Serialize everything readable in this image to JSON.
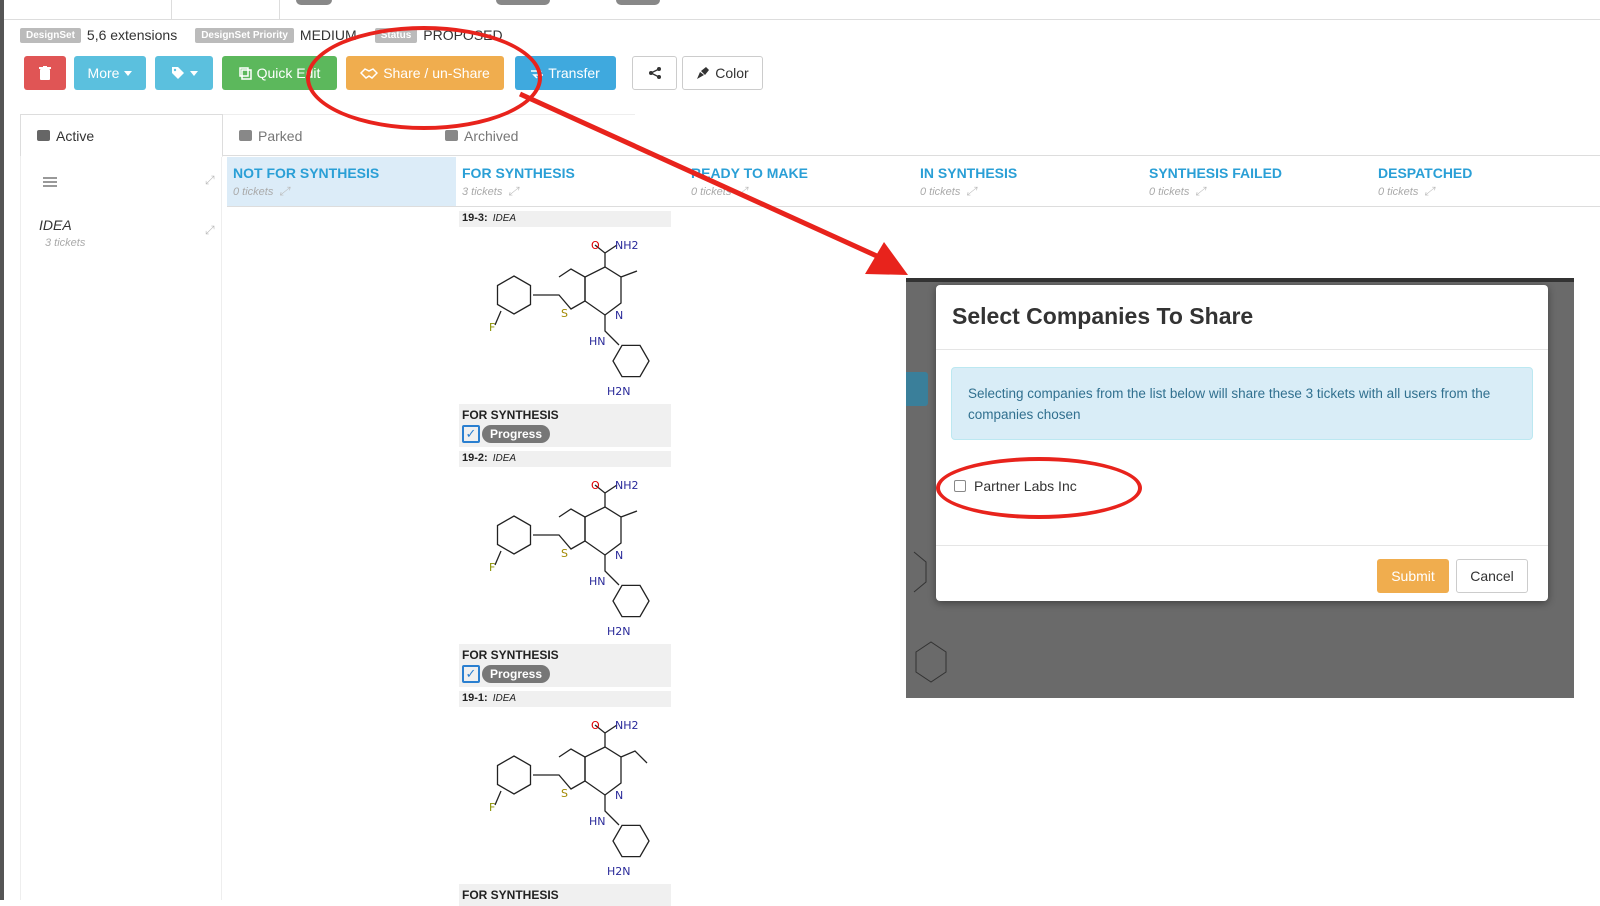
{
  "meta": {
    "designset_label": "DesignSet",
    "designset_value": "5,6 extensions",
    "priority_label": "DesignSet Priority",
    "priority_value": "MEDIUM",
    "status_label": "Status",
    "status_value": "PROPOSED"
  },
  "toolbar": {
    "delete_icon": "trash-icon",
    "more_label": "More",
    "tag_icon": "tag-icon",
    "quick_edit_label": "Quick Edit",
    "share_label": "Share / un-Share",
    "transfer_label": "Transfer",
    "share_icon": "share-nodes-icon",
    "color_label": "Color"
  },
  "status_tabs": [
    {
      "label": "Active"
    },
    {
      "label": "Parked"
    },
    {
      "label": "Archived"
    }
  ],
  "columns": [
    {
      "title": "NOT FOR SYNTHESIS",
      "count": "0 tickets"
    },
    {
      "title": "FOR SYNTHESIS",
      "count": "3 tickets"
    },
    {
      "title": "READY TO MAKE",
      "count": "0 tickets"
    },
    {
      "title": "IN SYNTHESIS",
      "count": "0 tickets"
    },
    {
      "title": "SYNTHESIS FAILED",
      "count": "0 tickets"
    },
    {
      "title": "DESPATCHED",
      "count": "0 tickets"
    }
  ],
  "row": {
    "title": "IDEA",
    "count": "3 tickets"
  },
  "cards": [
    {
      "id": "19-3:",
      "tag": "IDEA",
      "status": "FOR SYNTHESIS",
      "badge": "Progress"
    },
    {
      "id": "19-2:",
      "tag": "IDEA",
      "status": "FOR SYNTHESIS",
      "badge": "Progress"
    },
    {
      "id": "19-1:",
      "tag": "IDEA",
      "status": "FOR SYNTHESIS",
      "badge": ""
    }
  ],
  "molecule_atoms": {
    "o": "O",
    "nh2": "NH2",
    "n": "N",
    "s": "S",
    "f": "F",
    "hn": "HN",
    "h2n": "H2N"
  },
  "modal": {
    "title": "Select Companies To Share",
    "info": "Selecting companies from the list below will share these 3 tickets with all users from the companies chosen",
    "companies": [
      {
        "name": "Partner Labs Inc",
        "checked": false
      }
    ],
    "submit_label": "Submit",
    "cancel_label": "Cancel"
  },
  "colors": {
    "annotation": "#e8231c",
    "column_title": "#2a9fd6",
    "submit": "#f0ad4e"
  }
}
